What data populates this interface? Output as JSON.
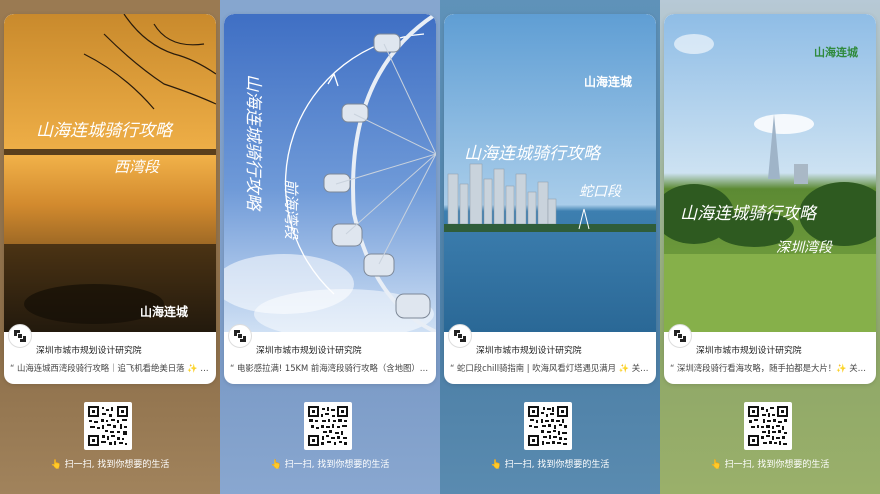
{
  "author": "深圳市城市规划设计研究院",
  "scan_prompt": "扫一扫, 找到你想要的生活",
  "scan_icon": "pointing-hand-icon",
  "brand_logo": "山海连城",
  "cards": [
    {
      "poster_title": "山海连城骑行攻略",
      "poster_subtitle": "西湾段",
      "description": "“ 山海连城西湾段骑行攻略｜追飞机看绝美日落 ✨ 关…",
      "palette": {
        "sky": "#e7a23a",
        "ground": "#3b2a14"
      }
    },
    {
      "poster_title": "山海连城骑行攻略",
      "poster_subtitle": "前海湾段",
      "description": "“ 电影感拉满! 15KM 前海湾段骑行攻略（含地图）…",
      "palette": {
        "sky": "#4a7fd0",
        "ground": "#d8e6f6"
      }
    },
    {
      "poster_title": "山海连城骑行攻略",
      "poster_subtitle": "蛇口段",
      "description": "“ 蛇口段chill骑指南 | 吹海风看灯塔遇见满月 ✨ 关…",
      "palette": {
        "sky": "#7fb3dc",
        "ground": "#2f6f9f"
      }
    },
    {
      "poster_title": "山海连城骑行攻略",
      "poster_subtitle": "深圳湾段",
      "description": "“ 深圳湾段骑行看海攻略，随手拍都是大片！✨ 关…",
      "palette": {
        "sky": "#a7c8e6",
        "ground": "#6f9a3a"
      }
    }
  ]
}
